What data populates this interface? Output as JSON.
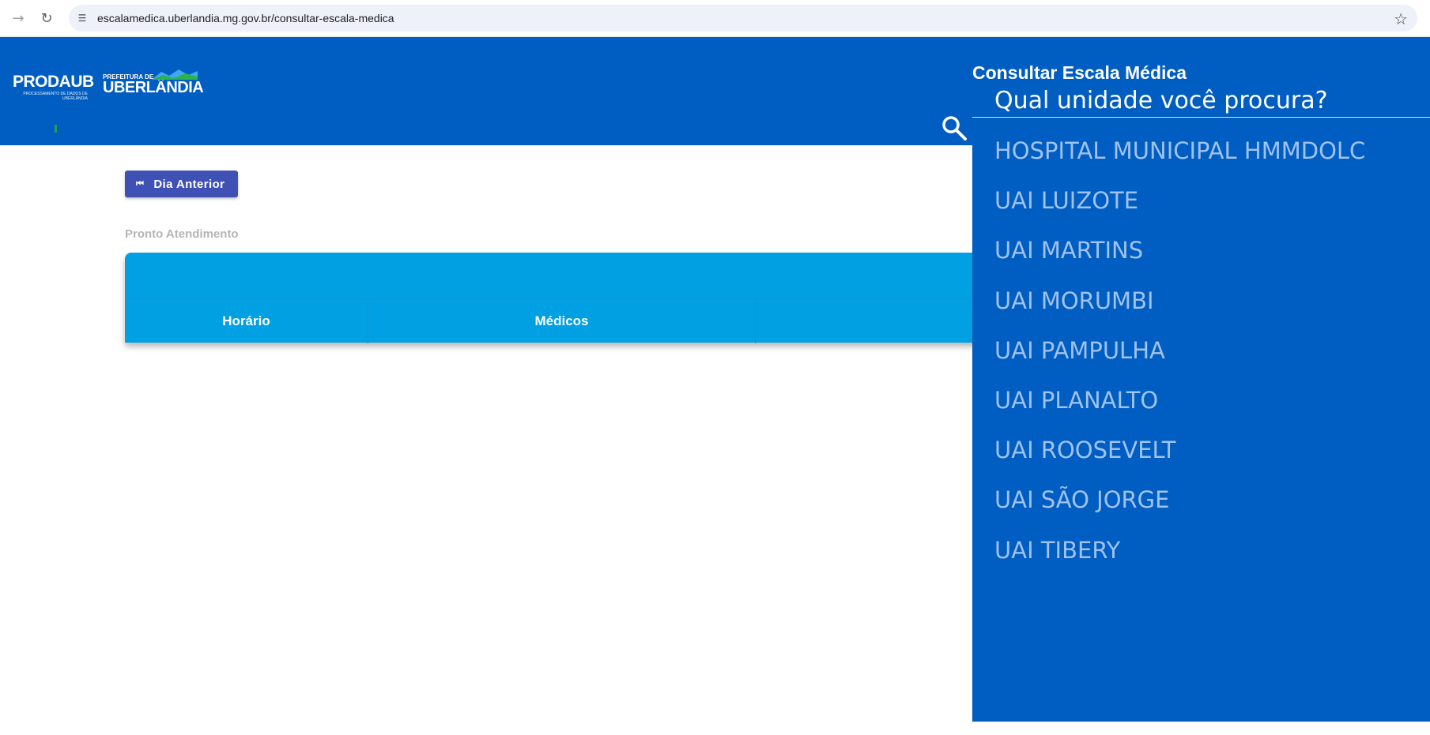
{
  "browser": {
    "url": "escalamedica.uberlandia.mg.gov.br/consultar-escala-medica",
    "forward_icon": "arrow-forward-icon",
    "reload_icon": "reload-icon",
    "site_info_icon": "tune-icon",
    "bookmark_icon": "star-outline-icon"
  },
  "header": {
    "logo_prodaub": "PRODAUB",
    "logo_prodaub_sub": "PROCESSAMENTO DE DADOS DE UBERLÂNDIA",
    "logo_prefeitura_pre": "PREFEITURA DE",
    "logo_prefeitura_main": "UBERLÂNDIA",
    "background_color": "#005dc1"
  },
  "toolbar": {
    "previous_day_label": "Dia Anterior"
  },
  "main": {
    "section_label": "Pronto Atendimento",
    "table_columns": [
      "Horário",
      "Médicos",
      ""
    ],
    "table_color": "#00a0e2"
  },
  "search_panel": {
    "title": "Consultar Escala Médica",
    "placeholder": "Qual unidade você procura?",
    "units": [
      "HOSPITAL MUNICIPAL HMMDOLC",
      "UAI LUIZOTE",
      "UAI MARTINS",
      "UAI MORUMBI",
      "UAI PAMPULHA",
      "UAI PLANALTO",
      "UAI ROOSEVELT",
      "UAI SÃO JORGE",
      "UAI TIBERY"
    ]
  }
}
